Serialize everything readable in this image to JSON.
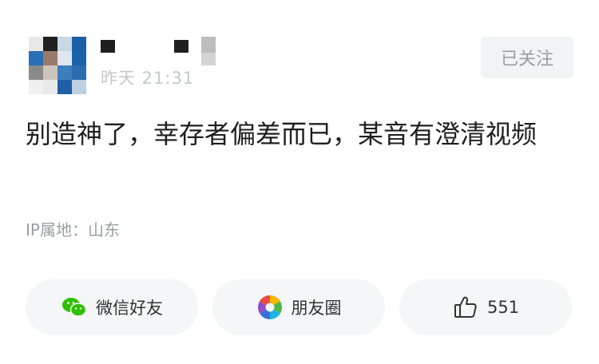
{
  "post": {
    "meta_time": "昨天 21:31",
    "follow_label": "已关注",
    "content": "别造神了，幸存者偏差而已，某音有澄清视频",
    "ip_location": "IP属地：山东"
  },
  "actions": {
    "wechat_label": "微信好友",
    "moments_label": "朋友圈",
    "like_count": "551"
  },
  "icons": {
    "wechat": "wechat-icon",
    "moments": "moments-icon",
    "like": "thumbs-up-icon"
  },
  "colors": {
    "wechat_green": "#2dc100",
    "follow_bg": "#f2f3f5",
    "muted_text": "#9a9da3"
  }
}
